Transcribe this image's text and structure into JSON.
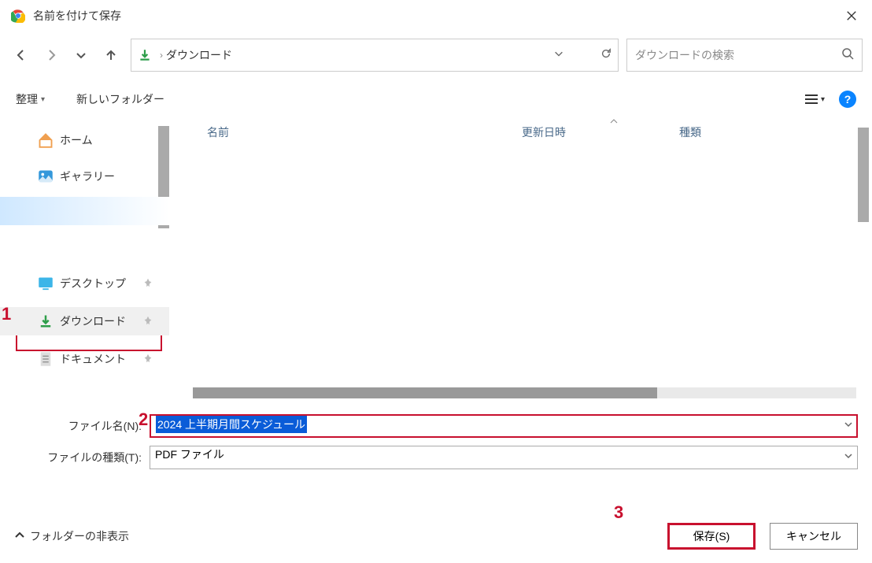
{
  "titlebar": {
    "title": "名前を付けて保存"
  },
  "pathbar": {
    "location": "ダウンロード"
  },
  "search": {
    "placeholder": "ダウンロードの検索"
  },
  "toolbar": {
    "organize": "整理",
    "new_folder": "新しいフォルダー"
  },
  "sidebar": {
    "home": "ホーム",
    "gallery": "ギャラリー",
    "desktop": "デスクトップ",
    "downloads": "ダウンロード",
    "documents": "ドキュメント"
  },
  "filelist": {
    "col_name": "名前",
    "col_date": "更新日時",
    "col_type": "種類"
  },
  "form": {
    "filename_label": "ファイル名(N):",
    "filename_value": "2024 上半期月間スケジュール",
    "filetype_label": "ファイルの種類(T):",
    "filetype_value": "PDF ファイル"
  },
  "footer": {
    "hide_folders": "フォルダーの非表示",
    "save": "保存(S)",
    "cancel": "キャンセル"
  },
  "annotations": {
    "a1": "1",
    "a2": "2",
    "a3": "3"
  }
}
